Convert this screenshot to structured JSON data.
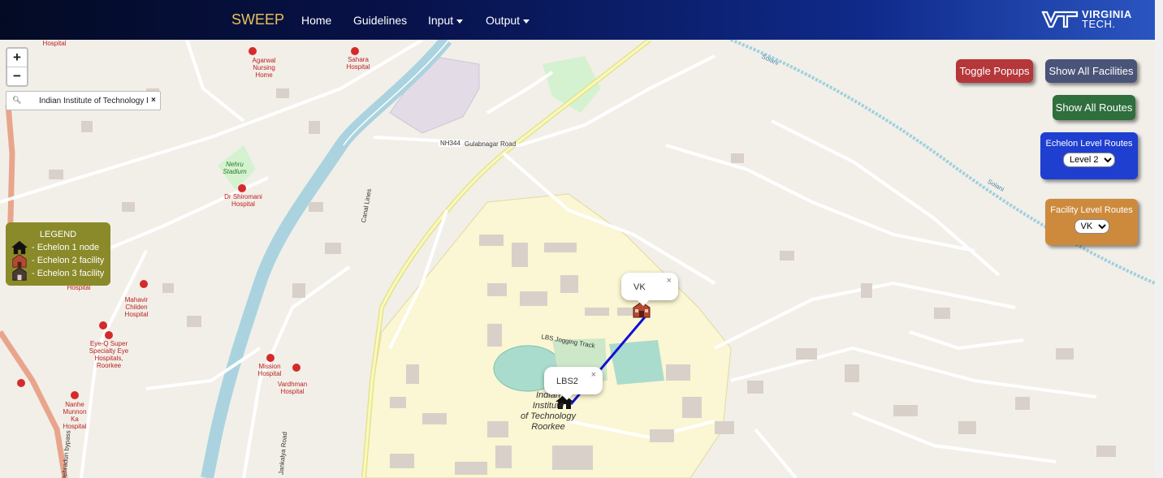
{
  "navbar": {
    "brand": "SWEEP",
    "items": [
      {
        "label": "Home",
        "dropdown": false
      },
      {
        "label": "Guidelines",
        "dropdown": false
      },
      {
        "label": "Input",
        "dropdown": true
      },
      {
        "label": "Output",
        "dropdown": true
      }
    ],
    "logo_text_line1": "VIRGINIA",
    "logo_text_line2": "TECH."
  },
  "map": {
    "zoom_in": "+",
    "zoom_out": "−",
    "search_value": "Indian Institute of Technology Roorkee",
    "search_icon": "search-icon",
    "search_close": "×",
    "labels": {
      "nh": "NH344",
      "road": "Gulabnagar Road",
      "solani1": "Solani",
      "solani2": "Solani",
      "campus1": "Indian",
      "campus2": "Institute",
      "campus3": "of Technology",
      "campus4": "Roorkee",
      "nehru": "Nehru Stadium",
      "lbs": "LBS Jogging Track",
      "canal": "Canal Lines",
      "jankalya": "Jankalya Road",
      "dehradun": "Dehradun bypass",
      "agarwal": "Agarwal Nursing Home",
      "sahara": "Sahara Hospital",
      "shiromani": "Dr Shiromani Hospital",
      "mahavir": "Mahavir Childen Hospital",
      "eyeq": "Eye-Q Super Specialty Eye Hospitals, Roorkee",
      "mission": "Mission Hospital",
      "vardhman": "Vardhman Hospital",
      "nanhe": "Nanhe Munnon Ka Hospital",
      "hospital_top": "Hospital",
      "hospital_mid": "Hospital"
    }
  },
  "legend": {
    "title": "LEGEND",
    "items": [
      {
        "label": "- Echelon 1 node",
        "icon": "house-icon"
      },
      {
        "label": "- Echelon 2 facility",
        "icon": "facility-red-icon"
      },
      {
        "label": "- Echelon 3 facility",
        "icon": "facility-dark-icon"
      }
    ]
  },
  "controls": {
    "toggle_popups": "Toggle Popups",
    "show_all_facilities": "Show All Facilities",
    "show_all_routes": "Show All Routes",
    "echelon_level": {
      "title": "Echelon Level Routes",
      "selected": "Level 2"
    },
    "facility_level": {
      "title": "Facility Level Routes",
      "selected": "VK"
    }
  },
  "popups": [
    {
      "label": "VK",
      "close": "×"
    },
    {
      "label": "LBS2",
      "close": "×"
    }
  ],
  "colors": {
    "toggle_popups": "#b5373a",
    "show_all_facilities": "#4a5478",
    "show_all_routes": "#2f6e3d",
    "echelon_panel": "#1f3fd0",
    "facility_panel": "#cd8a3c",
    "legend": "#8a8a2a",
    "route": "#1010d8"
  }
}
